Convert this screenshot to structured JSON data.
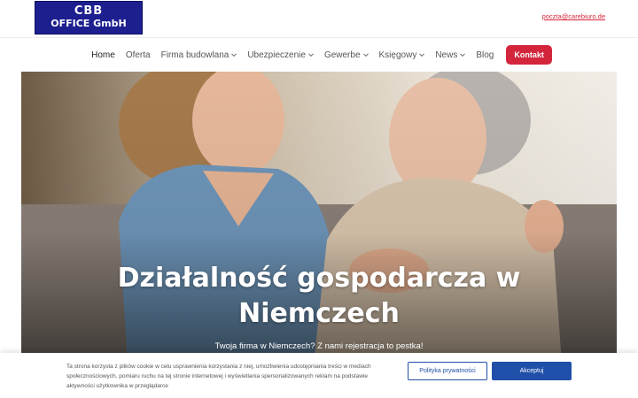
{
  "header": {
    "logo_line1": "CBB",
    "logo_line2": "OFFICE GmbH",
    "email": "poczta@carebiuro.de"
  },
  "nav": {
    "items": [
      {
        "label": "Home",
        "dropdown": false
      },
      {
        "label": "Oferta",
        "dropdown": false
      },
      {
        "label": "Firma budowlana",
        "dropdown": true
      },
      {
        "label": "Ubezpieczenie",
        "dropdown": true
      },
      {
        "label": "Gewerbe",
        "dropdown": true
      },
      {
        "label": "Księgowy",
        "dropdown": true
      },
      {
        "label": "News",
        "dropdown": true
      },
      {
        "label": "Blog",
        "dropdown": false
      }
    ],
    "cta": "Kontakt"
  },
  "hero": {
    "title_line1": "Działalność gospodarcza w",
    "title_line2": "Niemczech",
    "subtitle": "Twoja firma w Niemczech? Z nami rejestracja to pestka!"
  },
  "cookie_banner": {
    "text": "Ta strona korzysta z plików cookie w celu usprawnienia korzystania z niej, umożliwienia udostępniania treści w mediach społecznościowych, pomiaru ruchu na tej stronie internetowej i wyświetlania spersonalizowanych reklam na podstawie aktywności użytkownika w przeglądarce",
    "privacy_button": "Polityka prywatności",
    "accept_button": "Akceptuj"
  },
  "colors": {
    "brand_red": "#d3263c",
    "logo_blue": "#1d1f8f",
    "button_blue": "#1f4fa8"
  }
}
